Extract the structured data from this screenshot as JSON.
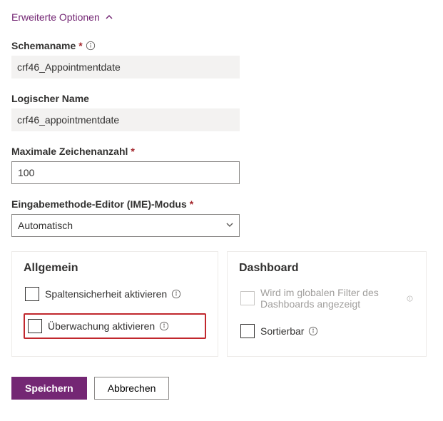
{
  "toggle": {
    "label": "Erweiterte Optionen"
  },
  "fields": {
    "schema": {
      "label": "Schemaname",
      "value": "crf46_Appointmentdate",
      "required": true,
      "info": true
    },
    "logical": {
      "label": "Logischer Name",
      "value": "crf46_appointmentdate",
      "required": false
    },
    "maxlen": {
      "label": "Maximale Zeichenanzahl",
      "value": "100",
      "required": true
    },
    "ime": {
      "label": "Eingabemethode-Editor (IME)-Modus",
      "value": "Automatisch",
      "required": true
    }
  },
  "cards": {
    "general": {
      "title": "Allgemein",
      "opt_security": "Spaltensicherheit aktivieren",
      "opt_audit": "Überwachung aktivieren"
    },
    "dashboard": {
      "title": "Dashboard",
      "opt_global_filter": "Wird im globalen Filter des Dashboards angezeigt",
      "opt_sortable": "Sortierbar"
    }
  },
  "buttons": {
    "save": "Speichern",
    "cancel": "Abbrechen"
  }
}
